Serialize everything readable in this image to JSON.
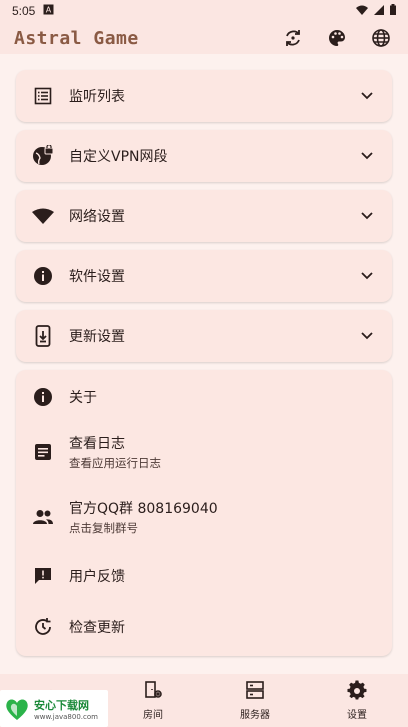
{
  "status_bar": {
    "time": "5:05"
  },
  "app": {
    "title": "Astral Game"
  },
  "header_actions": [
    "sync-icon",
    "palette-icon",
    "globe-icon"
  ],
  "settings_sections": [
    {
      "label": "监听列表",
      "icon": "list-icon"
    },
    {
      "label": "自定义VPN网段",
      "icon": "vpn-globe-lock-icon"
    },
    {
      "label": "网络设置",
      "icon": "wifi-icon"
    },
    {
      "label": "软件设置",
      "icon": "info-icon"
    },
    {
      "label": "更新设置",
      "icon": "phone-download-icon"
    }
  ],
  "about": {
    "about_label": "关于",
    "logs_label": "查看日志",
    "logs_sub": "查看应用运行日志",
    "qq_label": "官方QQ群 808169040",
    "qq_sub": "点击复制群号",
    "feedback_label": "用户反馈",
    "update_check_label": "检查更新"
  },
  "bottom_nav": [
    {
      "label": "",
      "icon": "home-icon"
    },
    {
      "label": "房间",
      "icon": "room-icon"
    },
    {
      "label": "服务器",
      "icon": "server-icon"
    },
    {
      "label": "设置",
      "icon": "gear-icon",
      "active": true
    }
  ],
  "watermark": {
    "main": "安心下载网",
    "sub": "www.java800.com"
  },
  "colors": {
    "background": "#fdf1ee",
    "card": "#fce7e2",
    "title": "#8a5a44",
    "text": "#2b1e1c"
  }
}
